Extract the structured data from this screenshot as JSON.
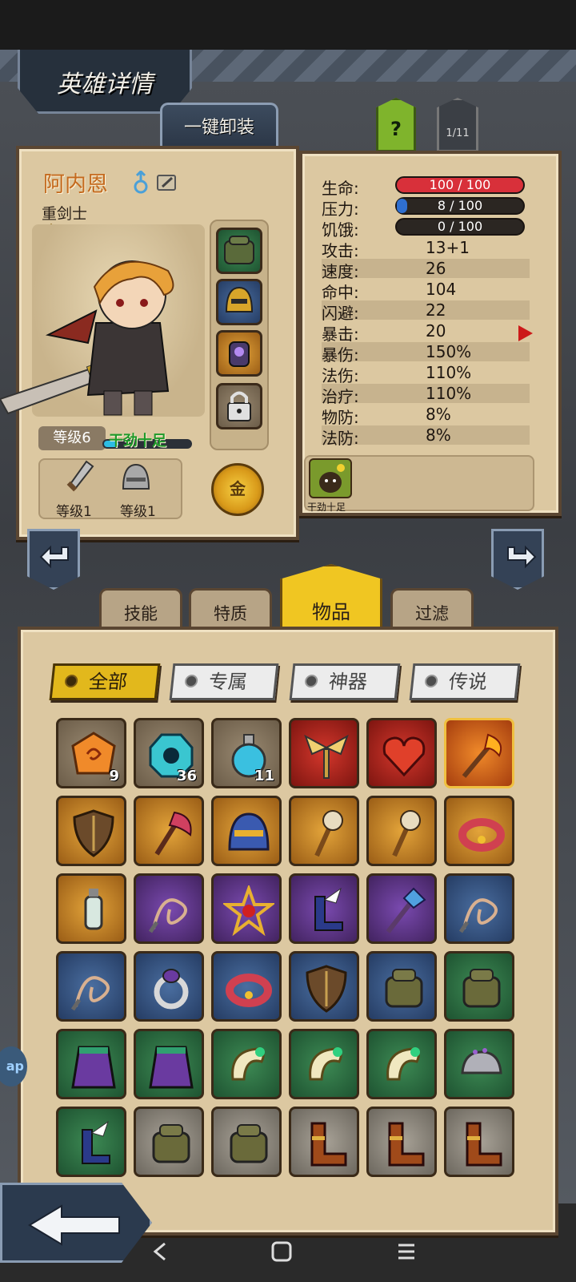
{
  "header": {
    "title": "英雄详情",
    "unequip_all": "一键卸装",
    "help": "?",
    "page": "1/11"
  },
  "hero": {
    "name": "阿内恩",
    "class": "重剑士",
    "level": "等级6",
    "mood": "干劲十足",
    "weapon_level": "等级1",
    "armor_level": "等级1",
    "gold_label": "金"
  },
  "stats": {
    "hp": {
      "label": "生命:",
      "value": "100 / 100",
      "fraction": 1.0,
      "color": "#d8303a"
    },
    "stress": {
      "label": "压力:",
      "value": "8 / 100",
      "fraction": 0.08,
      "color": "#2f6fd0"
    },
    "hunger": {
      "label": "饥饿:",
      "value": "0 / 100",
      "fraction": 0.0,
      "color": "#888888"
    },
    "rows": [
      {
        "label": "攻击:",
        "value": "13+1"
      },
      {
        "label": "速度:",
        "value": "26"
      },
      {
        "label": "命中:",
        "value": "104"
      },
      {
        "label": "闪避:",
        "value": "22"
      },
      {
        "label": "暴击:",
        "value": "20"
      },
      {
        "label": "暴伤:",
        "value": "150%"
      },
      {
        "label": "法伤:",
        "value": "110%"
      },
      {
        "label": "治疗:",
        "value": "110%"
      },
      {
        "label": "物防:",
        "value": "8%"
      },
      {
        "label": "法防:",
        "value": "8%"
      }
    ],
    "trait": "干劲十足"
  },
  "tabs": {
    "skills": "技能",
    "traits": "特质",
    "items": "物品",
    "filter": "过滤"
  },
  "categories": {
    "all": "全部",
    "exclusive": "专属",
    "artifact": "神器",
    "legend": "传说"
  },
  "inventory": [
    [
      {
        "icon": "amber-gem-icon",
        "q": "common",
        "qty": "9"
      },
      {
        "icon": "cyan-gem-icon",
        "q": "common",
        "qty": "36"
      },
      {
        "icon": "potion-icon",
        "q": "common",
        "qty": "11"
      },
      {
        "icon": "winged-mace-icon",
        "q": "red",
        "qty": ""
      },
      {
        "icon": "heart-icon",
        "q": "red",
        "qty": ""
      },
      {
        "icon": "flame-staff-icon",
        "q": "orange",
        "qty": ""
      }
    ],
    [
      {
        "icon": "shield-icon",
        "q": "gold",
        "qty": ""
      },
      {
        "icon": "axe-icon",
        "q": "gold",
        "qty": ""
      },
      {
        "icon": "helmet-icon",
        "q": "gold",
        "qty": ""
      },
      {
        "icon": "skull-staff-icon",
        "q": "gold",
        "qty": ""
      },
      {
        "icon": "skull-staff-icon",
        "q": "gold",
        "qty": ""
      },
      {
        "icon": "bracelet-icon",
        "q": "gold",
        "qty": ""
      }
    ],
    [
      {
        "icon": "vial-icon",
        "q": "gold",
        "qty": ""
      },
      {
        "icon": "whip-icon",
        "q": "purple",
        "qty": ""
      },
      {
        "icon": "star-amulet-icon",
        "q": "purple",
        "qty": ""
      },
      {
        "icon": "winged-boots-icon",
        "q": "purple",
        "qty": ""
      },
      {
        "icon": "crystal-wand-icon",
        "q": "purple",
        "qty": ""
      },
      {
        "icon": "whip-icon",
        "q": "blue",
        "qty": ""
      }
    ],
    [
      {
        "icon": "whip-icon",
        "q": "blue",
        "qty": ""
      },
      {
        "icon": "ring-icon",
        "q": "blue",
        "qty": ""
      },
      {
        "icon": "bracelet-icon",
        "q": "blue",
        "qty": ""
      },
      {
        "icon": "shield-icon",
        "q": "blue",
        "qty": ""
      },
      {
        "icon": "backpack-icon",
        "q": "blue",
        "qty": ""
      },
      {
        "icon": "backpack-icon",
        "q": "green",
        "qty": ""
      }
    ],
    [
      {
        "icon": "cloak-icon",
        "q": "green",
        "qty": ""
      },
      {
        "icon": "cloak-icon",
        "q": "green",
        "qty": ""
      },
      {
        "icon": "horn-icon",
        "q": "green",
        "qty": ""
      },
      {
        "icon": "horn-icon",
        "q": "green",
        "qty": ""
      },
      {
        "icon": "horn-icon",
        "q": "green",
        "qty": ""
      },
      {
        "icon": "cap-icon",
        "q": "green",
        "qty": ""
      }
    ],
    [
      {
        "icon": "winged-boots-icon",
        "q": "green",
        "qty": ""
      },
      {
        "icon": "backpack-icon",
        "q": "gray",
        "qty": ""
      },
      {
        "icon": "backpack-icon",
        "q": "gray",
        "qty": ""
      },
      {
        "icon": "boots-icon",
        "q": "gray",
        "qty": ""
      },
      {
        "icon": "boots-icon",
        "q": "gray",
        "qty": ""
      },
      {
        "icon": "boots-icon",
        "q": "gray",
        "qty": ""
      }
    ]
  ],
  "side_tag": "ap"
}
